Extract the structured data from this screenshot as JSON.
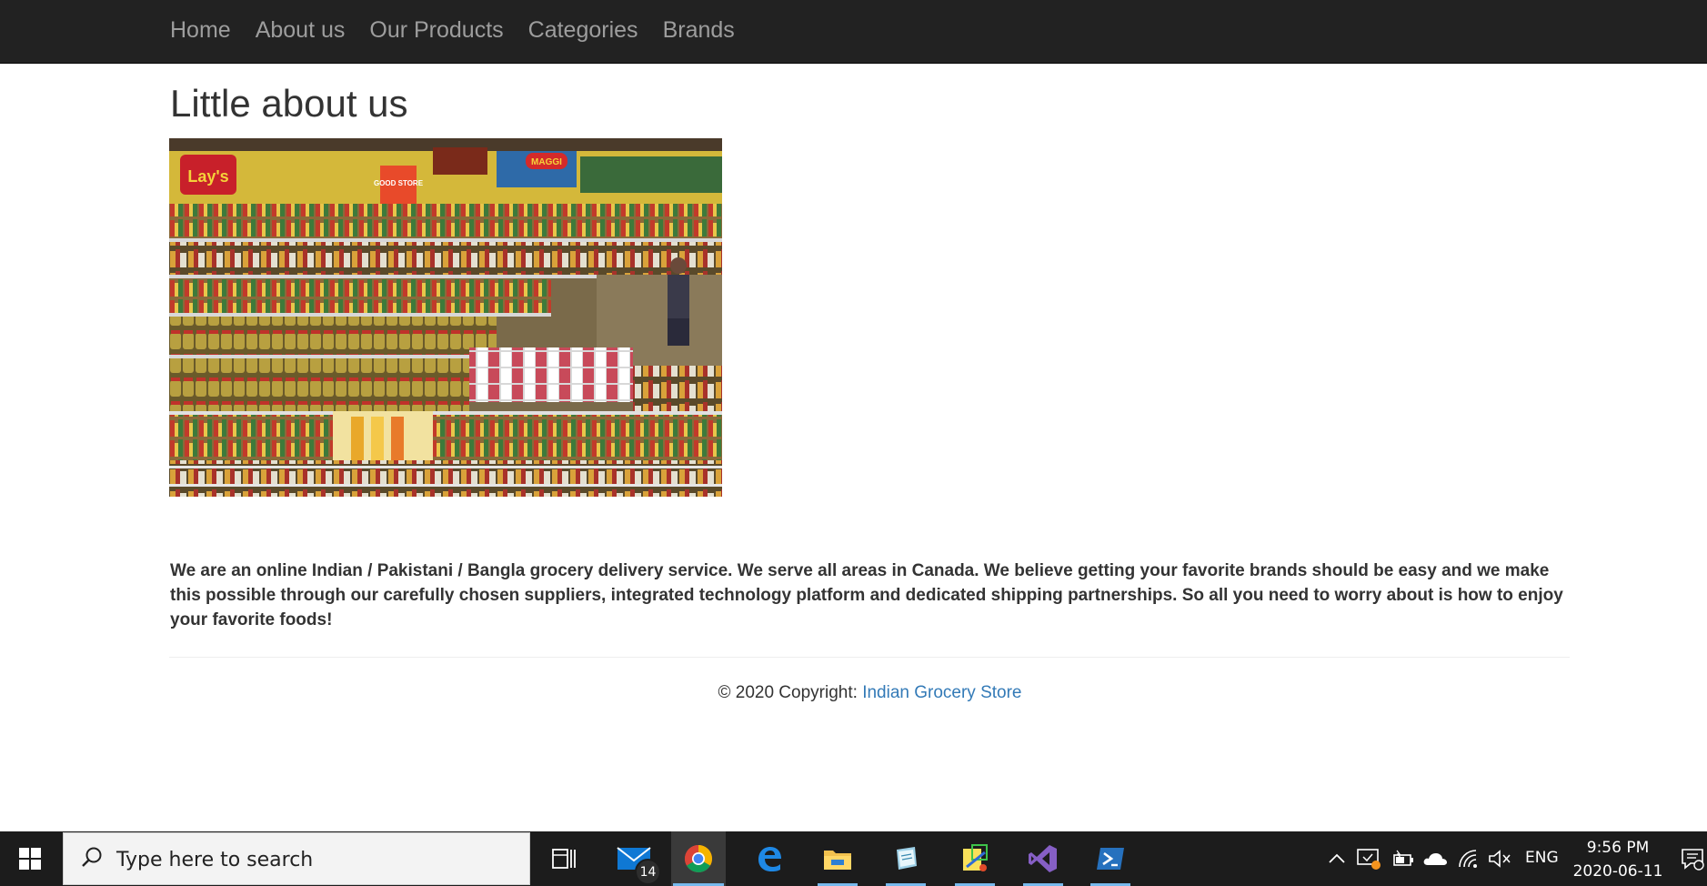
{
  "nav": {
    "items": [
      {
        "label": "Home"
      },
      {
        "label": "About us"
      },
      {
        "label": "Our Products"
      },
      {
        "label": "Categories"
      },
      {
        "label": "Brands"
      }
    ]
  },
  "main": {
    "title": "Little about us",
    "description": "We are an online Indian / Pakistani / Bangla grocery delivery service. We serve all areas in Canada. We believe getting your favorite brands should be easy and we make this possible through our carefully chosen suppliers, integrated technology platform and dedicated shipping partnerships. So all you need to worry about is how to enjoy your favorite foods!",
    "photo_signs": {
      "lays": "Lay's",
      "good_store": "GOOD STORE",
      "maggi": "MAGGI"
    }
  },
  "footer": {
    "prefix": "© 2020 Copyright: ",
    "link": "Indian Grocery Store"
  },
  "taskbar": {
    "search_placeholder": "Type here to search",
    "mail_badge": "14",
    "language": "ENG",
    "time": "9:56 PM",
    "date": "2020-06-11",
    "pinned": [
      "task-view-icon",
      "mail-icon",
      "chrome-icon",
      "edge-icon",
      "file-explorer-icon",
      "notes-app-icon",
      "sticky-notes-app-icon",
      "visual-studio-icon",
      "powershell-icon"
    ],
    "tray": [
      "chevron-up-icon",
      "device-icon",
      "battery-icon",
      "onedrive-icon",
      "wifi-icon",
      "volume-muted-icon",
      "notification-icon"
    ]
  },
  "colors": {
    "navbar_bg": "#222222",
    "nav_text": "#9d9d9d",
    "text": "#333333",
    "link": "#337ab7",
    "taskbar_bg": "#1c1c1c",
    "taskbar_accent": "#76b9ed"
  }
}
